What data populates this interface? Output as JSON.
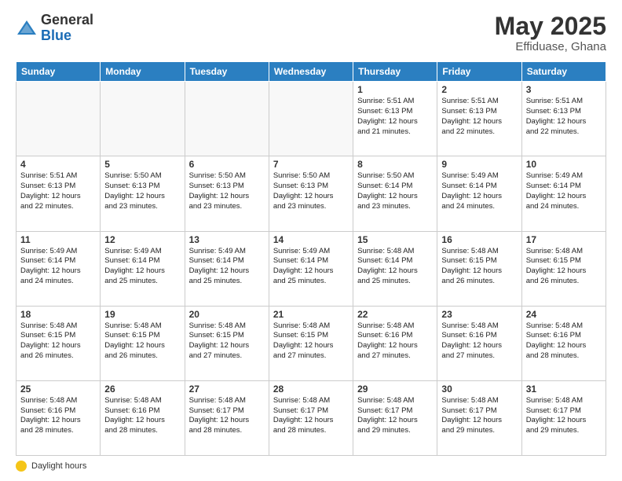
{
  "header": {
    "logo_general": "General",
    "logo_blue": "Blue",
    "month_year": "May 2025",
    "location": "Effiduase, Ghana"
  },
  "days_of_week": [
    "Sunday",
    "Monday",
    "Tuesday",
    "Wednesday",
    "Thursday",
    "Friday",
    "Saturday"
  ],
  "footer": {
    "label": "Daylight hours"
  },
  "weeks": [
    [
      {
        "day": "",
        "text": ""
      },
      {
        "day": "",
        "text": ""
      },
      {
        "day": "",
        "text": ""
      },
      {
        "day": "",
        "text": ""
      },
      {
        "day": "1",
        "text": "Sunrise: 5:51 AM\nSunset: 6:13 PM\nDaylight: 12 hours\nand 21 minutes."
      },
      {
        "day": "2",
        "text": "Sunrise: 5:51 AM\nSunset: 6:13 PM\nDaylight: 12 hours\nand 22 minutes."
      },
      {
        "day": "3",
        "text": "Sunrise: 5:51 AM\nSunset: 6:13 PM\nDaylight: 12 hours\nand 22 minutes."
      }
    ],
    [
      {
        "day": "4",
        "text": "Sunrise: 5:51 AM\nSunset: 6:13 PM\nDaylight: 12 hours\nand 22 minutes."
      },
      {
        "day": "5",
        "text": "Sunrise: 5:50 AM\nSunset: 6:13 PM\nDaylight: 12 hours\nand 23 minutes."
      },
      {
        "day": "6",
        "text": "Sunrise: 5:50 AM\nSunset: 6:13 PM\nDaylight: 12 hours\nand 23 minutes."
      },
      {
        "day": "7",
        "text": "Sunrise: 5:50 AM\nSunset: 6:13 PM\nDaylight: 12 hours\nand 23 minutes."
      },
      {
        "day": "8",
        "text": "Sunrise: 5:50 AM\nSunset: 6:14 PM\nDaylight: 12 hours\nand 23 minutes."
      },
      {
        "day": "9",
        "text": "Sunrise: 5:49 AM\nSunset: 6:14 PM\nDaylight: 12 hours\nand 24 minutes."
      },
      {
        "day": "10",
        "text": "Sunrise: 5:49 AM\nSunset: 6:14 PM\nDaylight: 12 hours\nand 24 minutes."
      }
    ],
    [
      {
        "day": "11",
        "text": "Sunrise: 5:49 AM\nSunset: 6:14 PM\nDaylight: 12 hours\nand 24 minutes."
      },
      {
        "day": "12",
        "text": "Sunrise: 5:49 AM\nSunset: 6:14 PM\nDaylight: 12 hours\nand 25 minutes."
      },
      {
        "day": "13",
        "text": "Sunrise: 5:49 AM\nSunset: 6:14 PM\nDaylight: 12 hours\nand 25 minutes."
      },
      {
        "day": "14",
        "text": "Sunrise: 5:49 AM\nSunset: 6:14 PM\nDaylight: 12 hours\nand 25 minutes."
      },
      {
        "day": "15",
        "text": "Sunrise: 5:48 AM\nSunset: 6:14 PM\nDaylight: 12 hours\nand 25 minutes."
      },
      {
        "day": "16",
        "text": "Sunrise: 5:48 AM\nSunset: 6:15 PM\nDaylight: 12 hours\nand 26 minutes."
      },
      {
        "day": "17",
        "text": "Sunrise: 5:48 AM\nSunset: 6:15 PM\nDaylight: 12 hours\nand 26 minutes."
      }
    ],
    [
      {
        "day": "18",
        "text": "Sunrise: 5:48 AM\nSunset: 6:15 PM\nDaylight: 12 hours\nand 26 minutes."
      },
      {
        "day": "19",
        "text": "Sunrise: 5:48 AM\nSunset: 6:15 PM\nDaylight: 12 hours\nand 26 minutes."
      },
      {
        "day": "20",
        "text": "Sunrise: 5:48 AM\nSunset: 6:15 PM\nDaylight: 12 hours\nand 27 minutes."
      },
      {
        "day": "21",
        "text": "Sunrise: 5:48 AM\nSunset: 6:15 PM\nDaylight: 12 hours\nand 27 minutes."
      },
      {
        "day": "22",
        "text": "Sunrise: 5:48 AM\nSunset: 6:16 PM\nDaylight: 12 hours\nand 27 minutes."
      },
      {
        "day": "23",
        "text": "Sunrise: 5:48 AM\nSunset: 6:16 PM\nDaylight: 12 hours\nand 27 minutes."
      },
      {
        "day": "24",
        "text": "Sunrise: 5:48 AM\nSunset: 6:16 PM\nDaylight: 12 hours\nand 28 minutes."
      }
    ],
    [
      {
        "day": "25",
        "text": "Sunrise: 5:48 AM\nSunset: 6:16 PM\nDaylight: 12 hours\nand 28 minutes."
      },
      {
        "day": "26",
        "text": "Sunrise: 5:48 AM\nSunset: 6:16 PM\nDaylight: 12 hours\nand 28 minutes."
      },
      {
        "day": "27",
        "text": "Sunrise: 5:48 AM\nSunset: 6:17 PM\nDaylight: 12 hours\nand 28 minutes."
      },
      {
        "day": "28",
        "text": "Sunrise: 5:48 AM\nSunset: 6:17 PM\nDaylight: 12 hours\nand 28 minutes."
      },
      {
        "day": "29",
        "text": "Sunrise: 5:48 AM\nSunset: 6:17 PM\nDaylight: 12 hours\nand 29 minutes."
      },
      {
        "day": "30",
        "text": "Sunrise: 5:48 AM\nSunset: 6:17 PM\nDaylight: 12 hours\nand 29 minutes."
      },
      {
        "day": "31",
        "text": "Sunrise: 5:48 AM\nSunset: 6:17 PM\nDaylight: 12 hours\nand 29 minutes."
      }
    ]
  ]
}
